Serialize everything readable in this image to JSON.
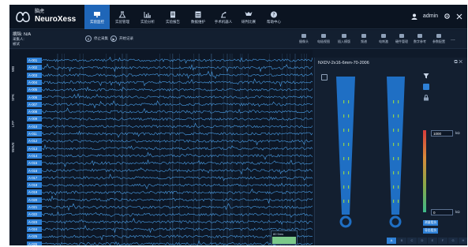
{
  "app": {
    "logo_cn": "脑虎",
    "logo_en": "NeuroXess"
  },
  "nav": [
    {
      "label": "实验监控",
      "active": true,
      "icon": "monitor-icon"
    },
    {
      "label": "实验管理",
      "active": false,
      "icon": "flask-icon"
    },
    {
      "label": "实验分析",
      "active": false,
      "icon": "chart-icon"
    },
    {
      "label": "实验报告",
      "active": false,
      "icon": "report-icon"
    },
    {
      "label": "数据维护",
      "active": false,
      "icon": "database-icon"
    },
    {
      "label": "手术机器人",
      "active": false,
      "icon": "robot-arm-icon"
    },
    {
      "label": "研判比赛",
      "active": false,
      "icon": "trophy-icon"
    },
    {
      "label": "帮助中心",
      "active": false,
      "icon": "help-icon"
    }
  ],
  "user": {
    "name": "admin"
  },
  "record": {
    "title": "摘除: N/A",
    "line2": "采集人:",
    "line3": "被试"
  },
  "controls": {
    "stop": "停止采集",
    "start": "开始记录"
  },
  "tools": [
    {
      "label": "摄像头",
      "icon": "camera-icon"
    },
    {
      "label": "电极视图",
      "icon": "grid-icon"
    },
    {
      "label": "插入模版",
      "icon": "template-icon"
    },
    {
      "label": "频谱",
      "icon": "spectrum-icon"
    },
    {
      "label": "电刺激",
      "icon": "stim-icon"
    },
    {
      "label": "硬件管理",
      "icon": "hardware-icon"
    },
    {
      "label": "数字参考",
      "icon": "reference-icon"
    },
    {
      "label": "参数配置",
      "icon": "config-icon"
    }
  ],
  "more": "...",
  "side_labels": [
    "WB",
    "SPK",
    "LFP",
    "WAVE"
  ],
  "channels": [
    "A-001",
    "A-002",
    "A-003",
    "A-004",
    "A-005",
    "A-006",
    "A-007",
    "A-008",
    "A-009",
    "A-010",
    "A-011",
    "A-012",
    "A-013",
    "A-014",
    "A-015",
    "A-016",
    "A-017",
    "A-018",
    "A-019",
    "A-020",
    "A-021",
    "A-022",
    "A-023",
    "A-024",
    "A-025",
    "A-026"
  ],
  "mini_scale": "80 5ms",
  "panel": {
    "title": "NXDV-2x16-6mm-70-2006",
    "scale_top": "1000",
    "scale_bottom": "0",
    "unit_top": "kΩ",
    "unit_bottom": "kΩ",
    "btn1": "测量阻抗",
    "btn2": "导出阻抗",
    "letters": [
      "A",
      "B",
      "C",
      "D",
      "E",
      "F",
      "G",
      "H"
    ],
    "active_letter": "A"
  },
  "colors": {
    "accent": "#2e80d6",
    "nav_active": "#1f66b8",
    "wave": "#4a9fe8",
    "probe": "#1f6fc4",
    "contact": "#8fd14f"
  }
}
